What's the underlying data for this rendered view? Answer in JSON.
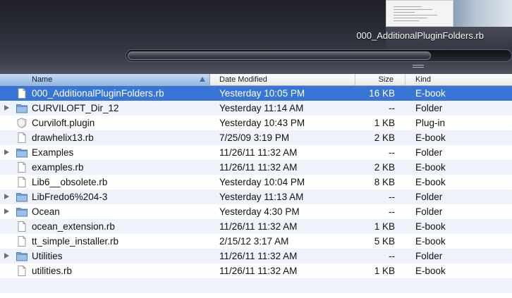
{
  "coverflow": {
    "title": "000_AdditionalPluginFolders.rb"
  },
  "columns": {
    "name": "Name",
    "date": "Date Modified",
    "size": "Size",
    "kind": "Kind"
  },
  "files": [
    {
      "name": "000_AdditionalPluginFolders.rb",
      "date": "Yesterday 10:05 PM",
      "size": "16 KB",
      "kind": "E-book",
      "icon": "document-icon",
      "expandable": false,
      "selected": true
    },
    {
      "name": "CURVILOFT_Dir_12",
      "date": "Yesterday 11:14 AM",
      "size": "--",
      "kind": "Folder",
      "icon": "folder-icon",
      "expandable": true,
      "selected": false
    },
    {
      "name": "Curviloft.plugin",
      "date": "Yesterday 10:43 PM",
      "size": "1 KB",
      "kind": "Plug-in",
      "icon": "plugin-icon",
      "expandable": false,
      "selected": false
    },
    {
      "name": "drawhelix13.rb",
      "date": "7/25/09 3:19 PM",
      "size": "2 KB",
      "kind": "E-book",
      "icon": "document-icon",
      "expandable": false,
      "selected": false
    },
    {
      "name": "Examples",
      "date": "11/26/11 11:32 AM",
      "size": "--",
      "kind": "Folder",
      "icon": "folder-icon",
      "expandable": true,
      "selected": false
    },
    {
      "name": "examples.rb",
      "date": "11/26/11 11:32 AM",
      "size": "2 KB",
      "kind": "E-book",
      "icon": "document-icon",
      "expandable": false,
      "selected": false
    },
    {
      "name": "Lib6__obsolete.rb",
      "date": "Yesterday 10:04 PM",
      "size": "8 KB",
      "kind": "E-book",
      "icon": "document-icon",
      "expandable": false,
      "selected": false
    },
    {
      "name": "LibFredo6%204-3",
      "date": "Yesterday 11:13 AM",
      "size": "--",
      "kind": "Folder",
      "icon": "folder-icon",
      "expandable": true,
      "selected": false
    },
    {
      "name": "Ocean",
      "date": "Yesterday 4:30 PM",
      "size": "--",
      "kind": "Folder",
      "icon": "folder-icon",
      "expandable": true,
      "selected": false
    },
    {
      "name": "ocean_extension.rb",
      "date": "11/26/11 11:32 AM",
      "size": "1 KB",
      "kind": "E-book",
      "icon": "document-icon",
      "expandable": false,
      "selected": false
    },
    {
      "name": "tt_simple_installer.rb",
      "date": "2/15/12 3:17 AM",
      "size": "5 KB",
      "kind": "E-book",
      "icon": "document-icon",
      "expandable": false,
      "selected": false
    },
    {
      "name": "Utilities",
      "date": "11/26/11 11:32 AM",
      "size": "--",
      "kind": "Folder",
      "icon": "folder-icon",
      "expandable": true,
      "selected": false
    },
    {
      "name": "utilities.rb",
      "date": "11/26/11 11:32 AM",
      "size": "1 KB",
      "kind": "E-book",
      "icon": "document-icon",
      "expandable": false,
      "selected": false
    }
  ],
  "colors": {
    "selection": "#3875d7",
    "alternate_row": "#eef3fb",
    "folder": "#7aa7d8"
  }
}
